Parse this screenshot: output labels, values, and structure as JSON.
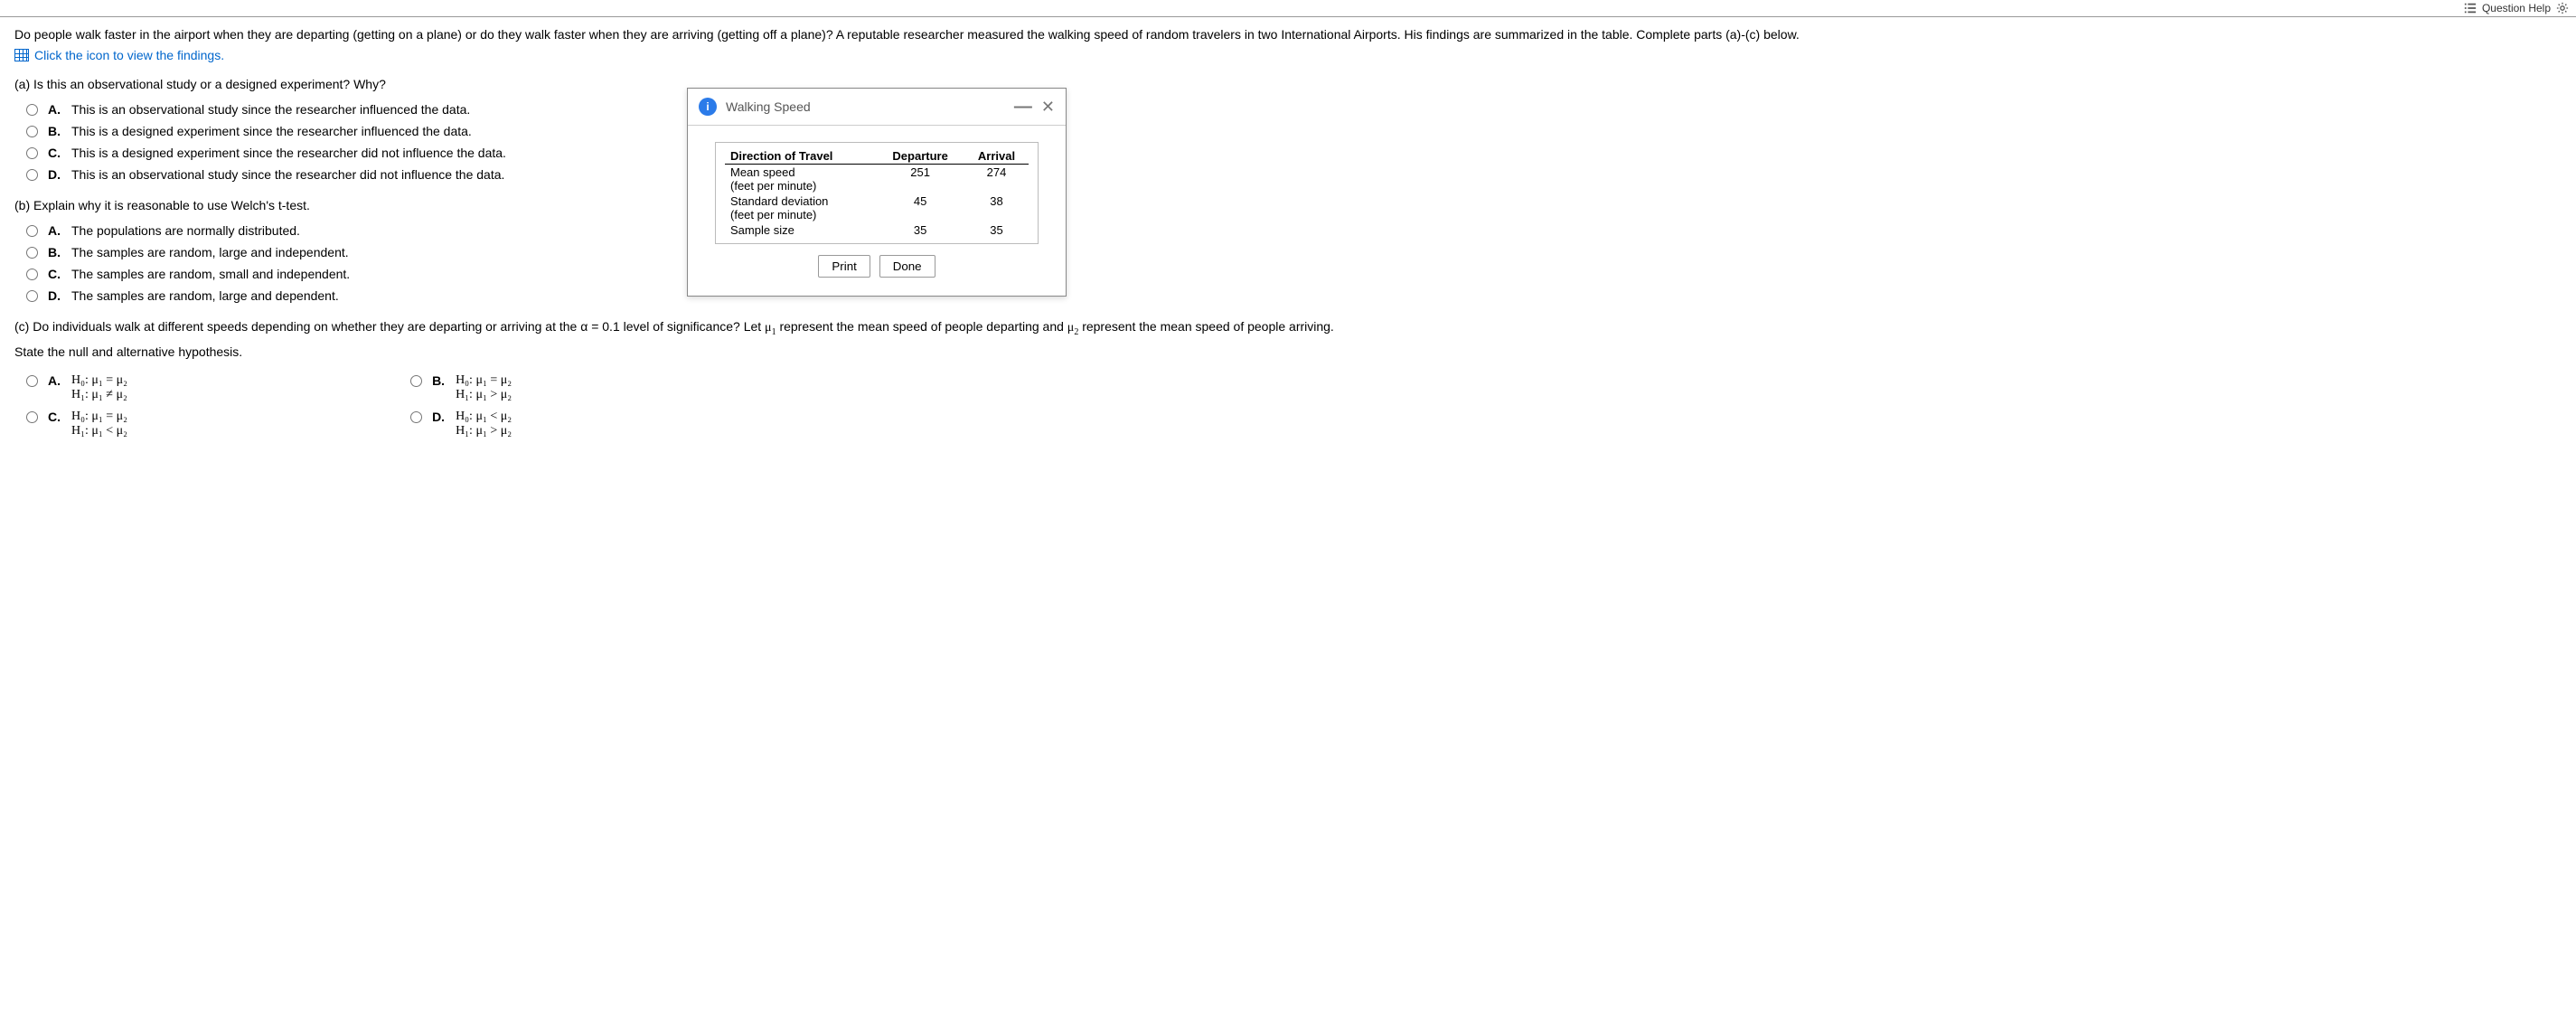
{
  "topbar": {
    "label": "Question Help"
  },
  "intro": "Do people walk faster in the airport when they are departing (getting on a plane) or do they walk faster when they are arriving (getting off a plane)? A reputable researcher measured the walking speed of random travelers in two International Airports. His findings are summarized in the table. Complete parts (a)-(c) below.",
  "click_link": "Click the icon to view the findings.",
  "qa": {
    "prompt": "(a) Is this an observational study or a designed experiment? Why?",
    "choices": {
      "A": "This is an observational study since the researcher influenced the data.",
      "B": "This is a designed experiment since the researcher influenced the data.",
      "C": "This is a designed experiment since the researcher did not influence the data.",
      "D": "This is an observational study since the researcher did not influence the data."
    }
  },
  "qb": {
    "prompt": "(b) Explain why it is reasonable to use Welch's t-test.",
    "choices": {
      "A": "The populations are normally distributed.",
      "B": "The samples are random, large and independent.",
      "C": "The samples are random, small and independent.",
      "D": "The samples are random, large and dependent."
    }
  },
  "qc": {
    "prefix": "(c) Do individuals walk at different speeds depending on whether they are departing or arriving at the α = 0.1 level of significance? Let ",
    "mu1": "μ",
    "mu1_sub": "1",
    "mid": " represent the mean speed of people departing and ",
    "mu2": "μ",
    "mu2_sub": "2",
    "suffix": " represent the mean speed of people arriving.",
    "state": "State the null and alternative hypothesis.",
    "choices": {
      "A": {
        "h0": "H₀: μ₁ = μ₂",
        "h1": "H₁: μ₁ ≠ μ₂"
      },
      "B": {
        "h0": "H₀: μ₁ = μ₂",
        "h1": "H₁: μ₁ > μ₂"
      },
      "C": {
        "h0": "H₀: μ₁ = μ₂",
        "h1": "H₁: μ₁ < μ₂"
      },
      "D": {
        "h0": "H₀: μ₁ < μ₂",
        "h1": "H₁: μ₁ > μ₂"
      }
    }
  },
  "popup": {
    "title": "Walking Speed",
    "minimize": "—",
    "close": "✕",
    "print": "Print",
    "done": "Done",
    "headers": {
      "direction": "Direction of Travel",
      "departure": "Departure",
      "arrival": "Arrival"
    },
    "rows": {
      "mean_label": "Mean speed",
      "mean_unit": "(feet per minute)",
      "mean_dep": "251",
      "mean_arr": "274",
      "sd_label": "Standard deviation",
      "sd_unit": "(feet per minute)",
      "sd_dep": "45",
      "sd_arr": "38",
      "size_label": "Sample size",
      "size_dep": "35",
      "size_arr": "35"
    }
  },
  "letters": {
    "A": "A.",
    "B": "B.",
    "C": "C.",
    "D": "D."
  }
}
